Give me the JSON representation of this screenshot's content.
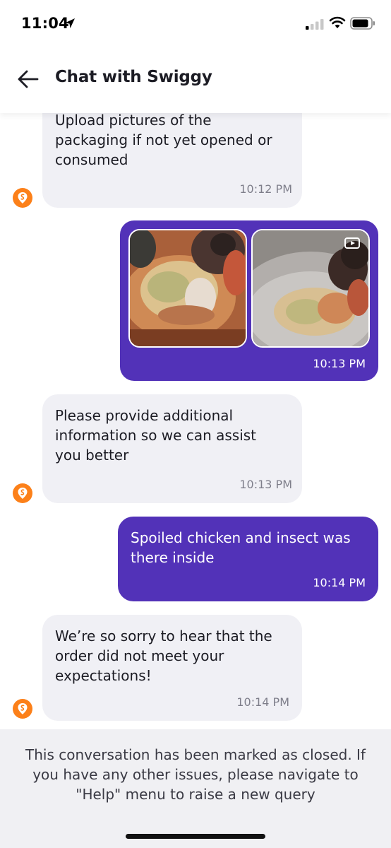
{
  "status_bar": {
    "time": "11:04"
  },
  "header": {
    "title": "Chat with Swiggy"
  },
  "messages": [
    {
      "from": "bot",
      "text": "Upload pictures of the\npackaging if not yet opened or\nconsumed",
      "time": "10:12 PM"
    },
    {
      "from": "user",
      "type": "images",
      "images": [
        "food-photo-1",
        "food-video-thumbnail"
      ],
      "time": "10:13 PM"
    },
    {
      "from": "bot",
      "text": "Please provide additional\ninformation so we can assist\nyou better",
      "time": "10:13 PM"
    },
    {
      "from": "user",
      "text": "Spoiled chicken and insect was\nthere inside",
      "time": "10:14 PM"
    },
    {
      "from": "bot",
      "text": "We’re so sorry to hear that the\norder did not meet your\nexpectations!",
      "time": "10:14 PM"
    }
  ],
  "closed_banner": {
    "text": "This conversation has been marked as closed. If you have any other issues, please navigate to \"Help\" menu to raise a new query"
  },
  "colors": {
    "brand_orange": "#fc8019",
    "user_bubble": "#5232b8",
    "bot_bubble": "#f0f0f5"
  },
  "icons": [
    "location-arrow-icon",
    "signal-icon",
    "wifi-icon",
    "battery-icon",
    "back-arrow-icon",
    "swiggy-logo-icon",
    "video-icon"
  ]
}
